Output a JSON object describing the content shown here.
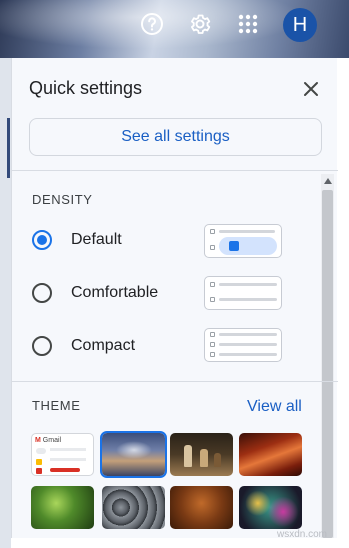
{
  "topbar": {
    "icons": [
      "help-icon",
      "settings-gear-icon",
      "apps-grid-icon"
    ],
    "avatar_initial": "H"
  },
  "quick_settings": {
    "title": "Quick settings",
    "see_all_label": "See all settings",
    "density": {
      "heading": "DENSITY",
      "selected": "Default",
      "options": [
        {
          "label": "Default",
          "checked": true
        },
        {
          "label": "Comfortable",
          "checked": false
        },
        {
          "label": "Compact",
          "checked": false
        }
      ]
    },
    "theme": {
      "heading": "THEME",
      "view_all_label": "View all",
      "thumbnails": [
        {
          "name": "gmail-default-theme",
          "wordmark": "Gmail",
          "selected": false
        },
        {
          "name": "stormy-sky-theme",
          "selected": true
        },
        {
          "name": "chess-pieces-theme",
          "selected": false
        },
        {
          "name": "canyon-theme",
          "selected": false
        },
        {
          "name": "green-plant-theme",
          "selected": false
        },
        {
          "name": "pipes-theme",
          "selected": false
        },
        {
          "name": "autumn-leaves-theme",
          "selected": false
        },
        {
          "name": "colorful-lights-theme",
          "selected": false
        }
      ]
    }
  },
  "watermark": "wsxdn.com",
  "colors": {
    "accent_blue": "#1a73e8",
    "link_blue": "#1a5fc4",
    "avatar_bg": "#1a53a8",
    "panel_bg": "#f6f8fc"
  }
}
